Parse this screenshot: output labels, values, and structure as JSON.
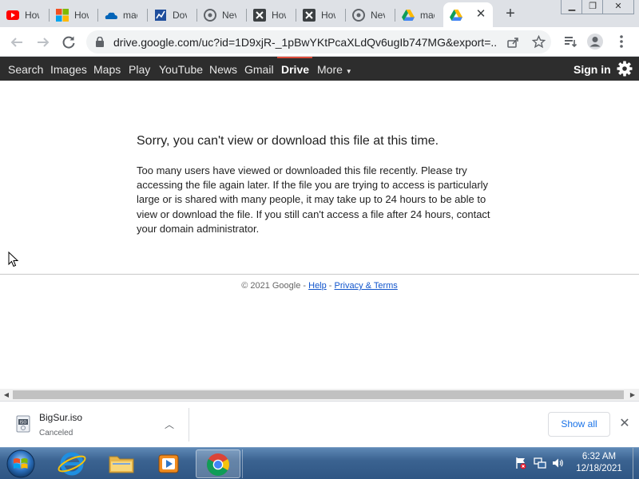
{
  "browser": {
    "tabs": [
      {
        "label": "How",
        "icon": "youtube-icon"
      },
      {
        "label": "How",
        "icon": "microsoft-icon"
      },
      {
        "label": "mac",
        "icon": "onedrive-icon"
      },
      {
        "label": "Dov",
        "icon": "download-site-icon"
      },
      {
        "label": "Nev",
        "icon": "chrome-icon"
      },
      {
        "label": "How",
        "icon": "x-site-icon"
      },
      {
        "label": "How",
        "icon": "x-site-icon"
      },
      {
        "label": "Nev",
        "icon": "chrome-icon"
      },
      {
        "label": "mac",
        "icon": "google-drive-icon"
      },
      {
        "label": "",
        "icon": "google-drive-icon"
      }
    ],
    "active_tab_index": 9,
    "new_tab_label": "+",
    "url": "drive.google.com/uc?id=1D9xjR-_1pBwYKtPcaXLdQv6ugIb747MG&export=..."
  },
  "google_bar": {
    "items": [
      "Search",
      "Images",
      "Maps",
      "Play",
      "YouTube",
      "News",
      "Gmail",
      "Drive",
      "More"
    ],
    "active": "Drive",
    "sign_in": "Sign in"
  },
  "page": {
    "title": "Sorry, you can't view or download this file at this time.",
    "body": "Too many users have viewed or downloaded this file recently. Please try accessing the file again later. If the file you are trying to access is particularly large or is shared with many people, it may take up to 24 hours to be able to view or download the file. If you still can't access a file after 24 hours, contact your domain administrator.",
    "footer_copyright": "© 2021 Google - ",
    "footer_help": "Help",
    "footer_separator": " - ",
    "footer_privacy": "Privacy & Terms"
  },
  "download": {
    "filename": "BigSur.iso",
    "status": "Canceled",
    "show_all": "Show all"
  },
  "taskbar": {
    "apps": [
      "internet-explorer-icon",
      "file-explorer-icon",
      "media-player-icon",
      "chrome-icon"
    ],
    "active_app": "chrome-icon",
    "time": "6:32 AM",
    "date": "12/18/2021"
  },
  "colors": {
    "google_bar_bg": "#2d2d2d",
    "drive_accent": "#dd4b39",
    "link": "#1155cc",
    "chrome_tabstrip": "#dee1e6"
  }
}
